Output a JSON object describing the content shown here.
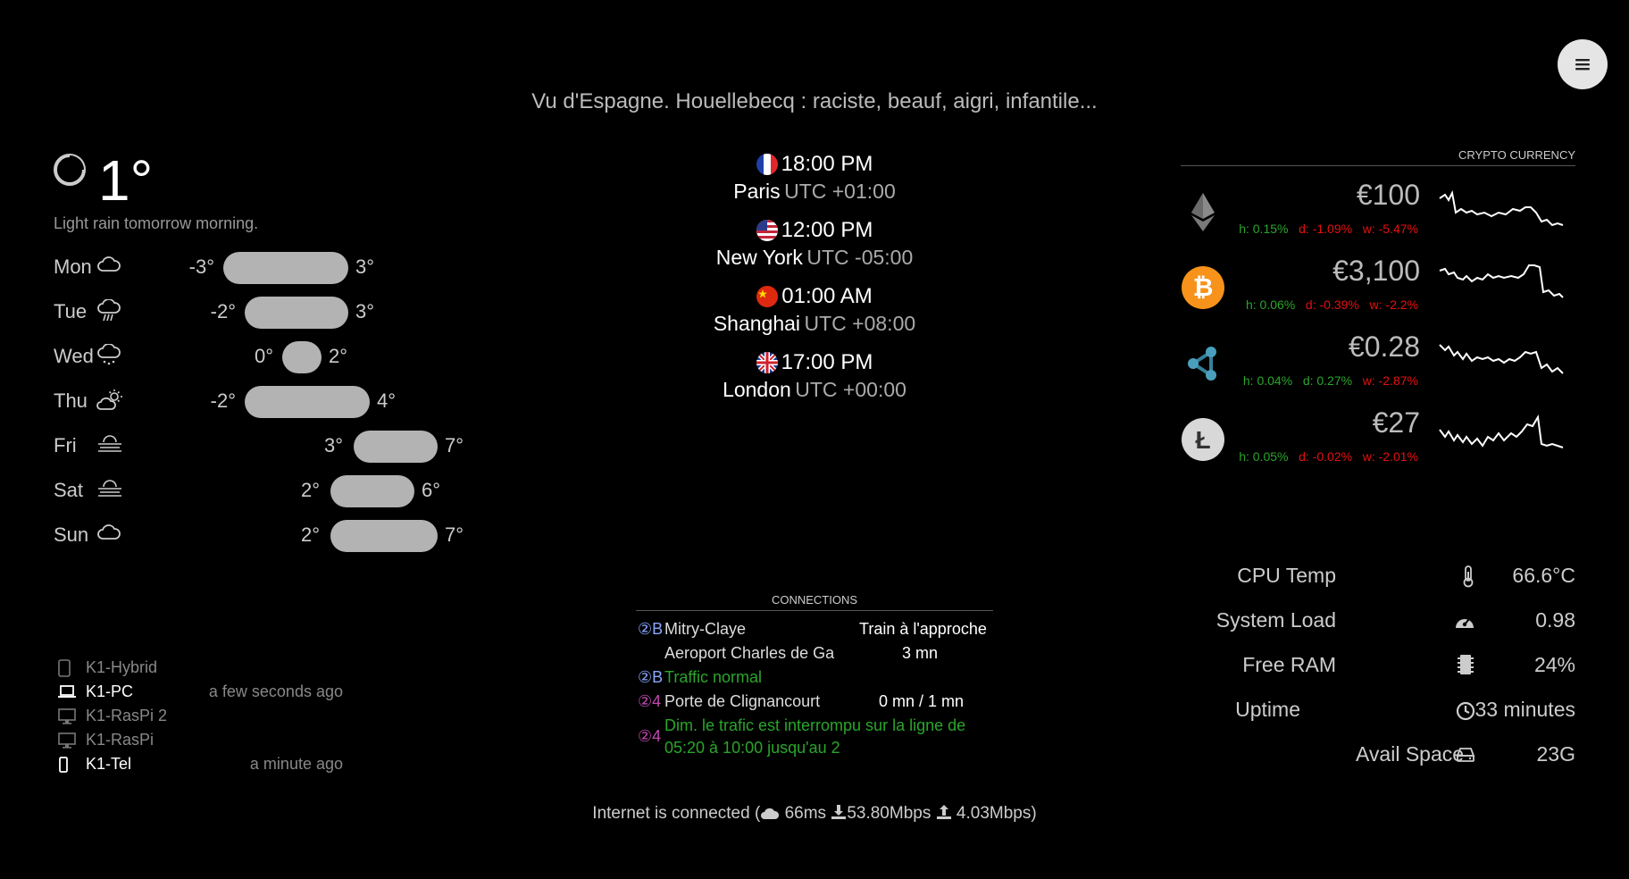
{
  "headline": "Vu d'Espagne. Houellebecq : raciste, beauf, aigri, infantile...",
  "weather": {
    "current_temp": "1°",
    "summary": "Light rain tomorrow morning.",
    "forecast": [
      {
        "day": "Mon",
        "icon": "cloud-icon",
        "min": "-3°",
        "max": "3°"
      },
      {
        "day": "Tue",
        "icon": "rain-icon",
        "min": "-2°",
        "max": "3°"
      },
      {
        "day": "Wed",
        "icon": "snow-icon",
        "min": "0°",
        "max": "2°"
      },
      {
        "day": "Thu",
        "icon": "partly-cloudy-icon",
        "min": "-2°",
        "max": "4°"
      },
      {
        "day": "Fri",
        "icon": "fog-icon",
        "min": "3°",
        "max": "7°"
      },
      {
        "day": "Sat",
        "icon": "fog-icon",
        "min": "2°",
        "max": "6°"
      },
      {
        "day": "Sun",
        "icon": "cloud-icon",
        "min": "2°",
        "max": "7°"
      }
    ]
  },
  "clocks": [
    {
      "time": "18:00 PM",
      "city": "Paris",
      "utc": "UTC +01:00",
      "flag": "france-flag-icon"
    },
    {
      "time": "12:00 PM",
      "city": "New York",
      "utc": "UTC -05:00",
      "flag": "usa-flag-icon"
    },
    {
      "time": "01:00 AM",
      "city": "Shanghai",
      "utc": "UTC +08:00",
      "flag": "china-flag-icon"
    },
    {
      "time": "17:00 PM",
      "city": "London",
      "utc": "UTC +00:00",
      "flag": "uk-flag-icon"
    }
  ],
  "crypto": {
    "header": "CRYPTO CURRENCY",
    "coins": [
      {
        "icon": "ethereum-icon",
        "price": "€100",
        "h": "h: 0.15%",
        "d": "d: -1.09%",
        "w": "w: -5.47%"
      },
      {
        "icon": "bitcoin-icon",
        "price": "€3,100",
        "h": "h: 0.06%",
        "d": "d: -0.39%",
        "w": "w: -2.2%"
      },
      {
        "icon": "ripple-icon",
        "price": "€0.28",
        "h": "h: 0.04%",
        "d": "d: 0.27%",
        "w": "w: -2.87%"
      },
      {
        "icon": "litecoin-icon",
        "price": "€27",
        "h": "h: 0.05%",
        "d": "d: -0.02%",
        "w": "w: -2.01%"
      }
    ]
  },
  "system": {
    "cpu_label": "CPU Temp",
    "cpu_value": "66.6°C",
    "load_label": "System Load",
    "load_value": "0.98",
    "ram_label": "Free RAM",
    "ram_value": "24%",
    "uptime_label": "Uptime",
    "uptime_value": "33 minutes",
    "space_label": "Avail Space",
    "space_value": "23G"
  },
  "devices": [
    {
      "name": "K1-Hybrid",
      "icon": "tablet-icon",
      "time": "",
      "active": false
    },
    {
      "name": "K1-PC",
      "icon": "laptop-icon",
      "time": "a few seconds ago",
      "active": true
    },
    {
      "name": "K1-RasPi 2",
      "icon": "monitor-icon",
      "time": "",
      "active": false
    },
    {
      "name": "K1-RasPi",
      "icon": "monitor-icon",
      "time": "",
      "active": false
    },
    {
      "name": "K1-Tel",
      "icon": "phone-icon",
      "time": "a minute ago",
      "active": true
    }
  ],
  "connections": {
    "header": "CONNECTIONS",
    "r1_badge": "②B",
    "r1_stop": "Mitry-Claye",
    "r1_status": "Train à l'approche",
    "r2_stop": "Aeroport Charles de Ga",
    "r2_status": "3 mn",
    "r3_badge": "②B",
    "r3_info": "Traffic normal",
    "r4_badge": "②4",
    "r4_stop": "Porte de Clignancourt",
    "r4_status": "0 mn / 1 mn",
    "r5_badge": "②4",
    "r5_line1": "Dim. le trafic est interrompu sur la ligne de",
    "r5_line2": "05:20 à 10:00 jusqu'au 2"
  },
  "internet": {
    "status": "Internet is connected (",
    "ping": "66ms",
    "down": "53.80Mbps",
    "up": "4.03Mbps)"
  }
}
